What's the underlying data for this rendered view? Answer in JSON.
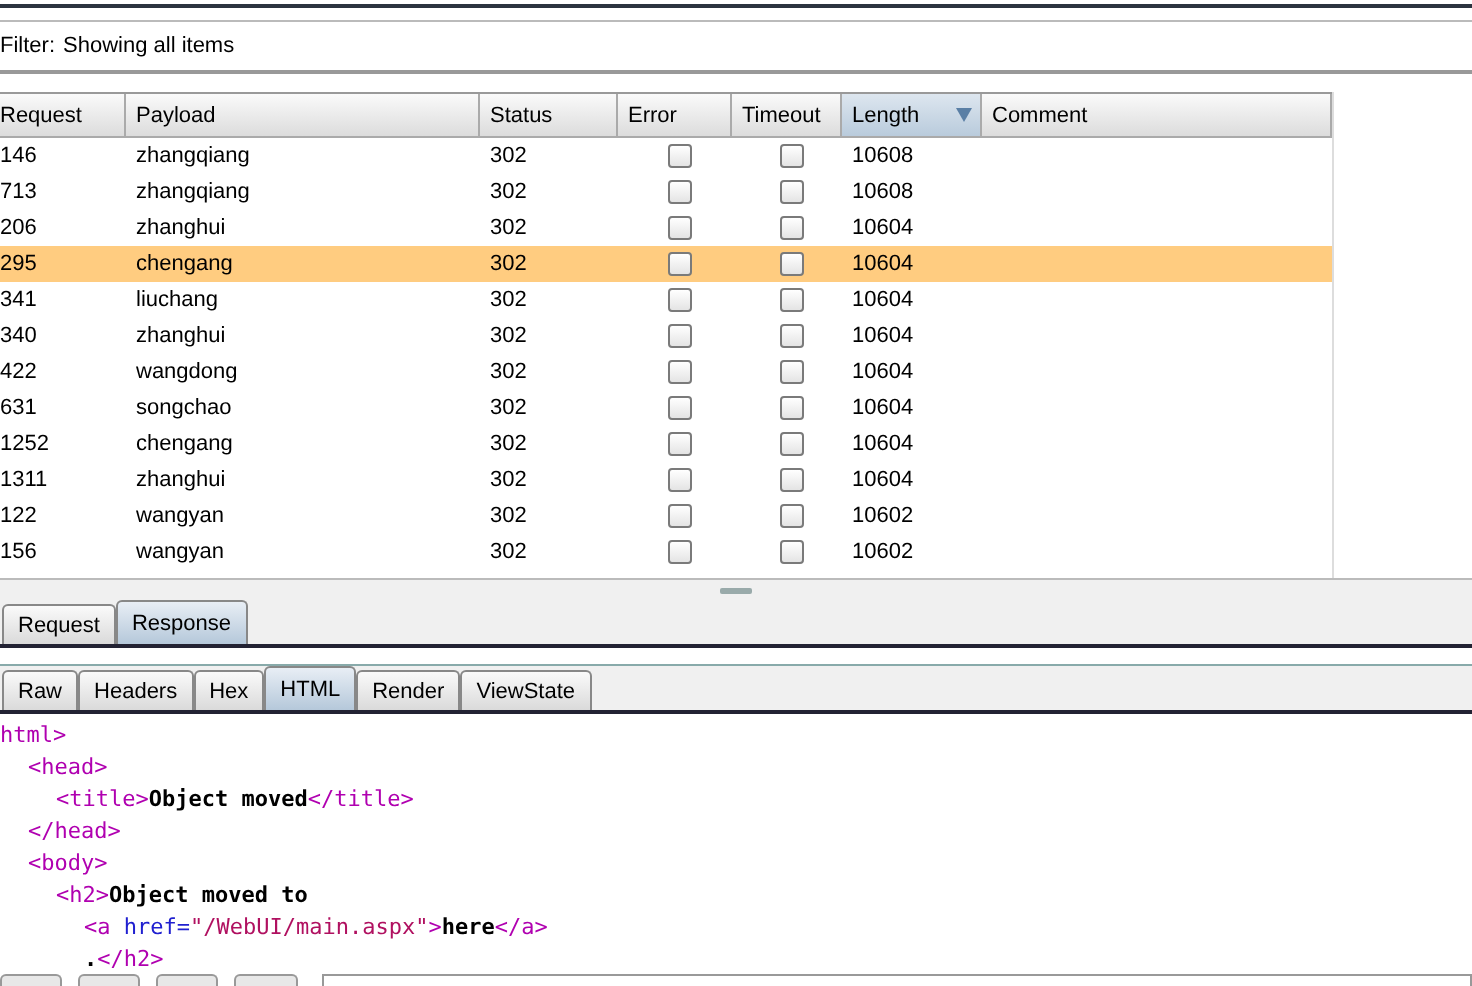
{
  "filter": {
    "label": "Filter:",
    "value": "Showing all items"
  },
  "table": {
    "columns": [
      {
        "label": "Request",
        "sorted": false
      },
      {
        "label": "Payload",
        "sorted": false
      },
      {
        "label": "Status",
        "sorted": false
      },
      {
        "label": "Error",
        "sorted": false
      },
      {
        "label": "Timeout",
        "sorted": false
      },
      {
        "label": "Length",
        "sorted": true
      },
      {
        "label": "Comment",
        "sorted": false
      }
    ],
    "rows": [
      {
        "request": "146",
        "payload": "zhangqiang",
        "status": "302",
        "error": false,
        "timeout": false,
        "length": "10608",
        "selected": false
      },
      {
        "request": "713",
        "payload": "zhangqiang",
        "status": "302",
        "error": false,
        "timeout": false,
        "length": "10608",
        "selected": false
      },
      {
        "request": "206",
        "payload": "zhanghui",
        "status": "302",
        "error": false,
        "timeout": false,
        "length": "10604",
        "selected": false
      },
      {
        "request": "295",
        "payload": "chengang",
        "status": "302",
        "error": false,
        "timeout": false,
        "length": "10604",
        "selected": true
      },
      {
        "request": "341",
        "payload": "liuchang",
        "status": "302",
        "error": false,
        "timeout": false,
        "length": "10604",
        "selected": false
      },
      {
        "request": "340",
        "payload": "zhanghui",
        "status": "302",
        "error": false,
        "timeout": false,
        "length": "10604",
        "selected": false
      },
      {
        "request": "422",
        "payload": "wangdong",
        "status": "302",
        "error": false,
        "timeout": false,
        "length": "10604",
        "selected": false
      },
      {
        "request": "631",
        "payload": "songchao",
        "status": "302",
        "error": false,
        "timeout": false,
        "length": "10604",
        "selected": false
      },
      {
        "request": "1252",
        "payload": "chengang",
        "status": "302",
        "error": false,
        "timeout": false,
        "length": "10604",
        "selected": false
      },
      {
        "request": "1311",
        "payload": "zhanghui",
        "status": "302",
        "error": false,
        "timeout": false,
        "length": "10604",
        "selected": false
      },
      {
        "request": "122",
        "payload": "wangyan",
        "status": "302",
        "error": false,
        "timeout": false,
        "length": "10602",
        "selected": false
      },
      {
        "request": "156",
        "payload": "wangyan",
        "status": "302",
        "error": false,
        "timeout": false,
        "length": "10602",
        "selected": false
      }
    ]
  },
  "message_tabs": [
    {
      "label": "Request",
      "selected": false
    },
    {
      "label": "Response",
      "selected": true
    }
  ],
  "view_tabs": [
    {
      "label": "Raw",
      "selected": false
    },
    {
      "label": "Headers",
      "selected": false
    },
    {
      "label": "Hex",
      "selected": false
    },
    {
      "label": "HTML",
      "selected": true
    },
    {
      "label": "Render",
      "selected": false
    },
    {
      "label": "ViewState",
      "selected": false
    }
  ],
  "code_lines": [
    {
      "tokens": [
        {
          "kind": "tag",
          "text": "html>"
        }
      ],
      "children": [
        {
          "tokens": [
            {
              "kind": "tag",
              "text": "<head>"
            }
          ],
          "children": [
            {
              "tokens": [
                {
                  "kind": "tag",
                  "text": "<title>"
                },
                {
                  "kind": "text",
                  "text": "Object moved"
                },
                {
                  "kind": "tag",
                  "text": "</title>"
                }
              ]
            }
          ]
        },
        {
          "tokens": [
            {
              "kind": "tag",
              "text": "</head>"
            }
          ]
        },
        {
          "tokens": [
            {
              "kind": "tag",
              "text": "<body>"
            }
          ],
          "children": [
            {
              "tokens": [
                {
                  "kind": "tag",
                  "text": "<h2>"
                },
                {
                  "kind": "text",
                  "text": "Object moved to"
                }
              ],
              "children": [
                {
                  "tokens": [
                    {
                      "kind": "tag",
                      "text": "<a "
                    },
                    {
                      "kind": "attr",
                      "text": "href="
                    },
                    {
                      "kind": "value",
                      "text": "\"/WebUI/main.aspx\""
                    },
                    {
                      "kind": "tag",
                      "text": ">"
                    },
                    {
                      "kind": "text",
                      "text": "here"
                    },
                    {
                      "kind": "tag",
                      "text": "</a>"
                    }
                  ]
                },
                {
                  "tokens": [
                    {
                      "kind": "text",
                      "text": "."
                    },
                    {
                      "kind": "tag",
                      "text": "</h2>"
                    }
                  ]
                }
              ]
            }
          ]
        }
      ]
    }
  ]
}
